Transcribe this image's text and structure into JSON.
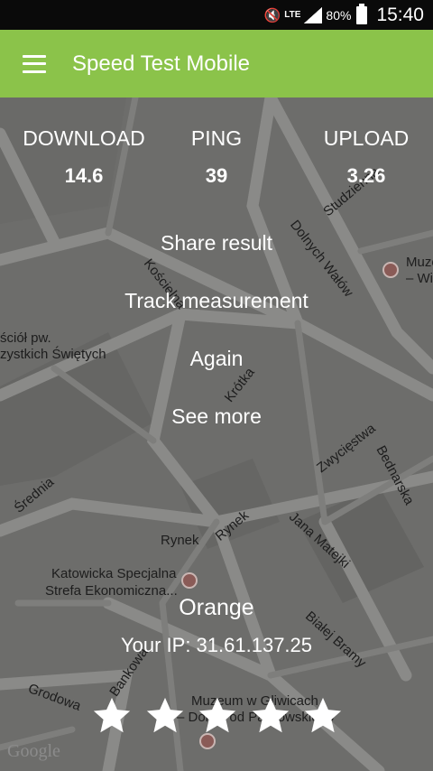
{
  "status_bar": {
    "time": "15:40",
    "battery": "80%",
    "network": "LTE"
  },
  "app_bar": {
    "title": "Speed Test Mobile"
  },
  "results": {
    "download": {
      "label": "DOWNLOAD",
      "value": "14.6"
    },
    "ping": {
      "label": "PING",
      "value": "39"
    },
    "upload": {
      "label": "UPLOAD",
      "value": "3.26"
    }
  },
  "actions": {
    "share": "Share result",
    "track": "Track measurement",
    "again": "Again",
    "see_more": "See more"
  },
  "connection": {
    "operator": "Orange",
    "ip": "Your IP: 31.61.137.25"
  },
  "rating": {
    "stars": 5
  },
  "map": {
    "labels": {
      "studzienna": "Studzienna",
      "dolnych_walow": "Dolnych Wałów",
      "koscielna": "Kościelna",
      "krotka": "Krótka",
      "kosciol_1": "ściół pw.",
      "kosciol_2": "zystkich Świętych",
      "muzeum_top_1": "Muze",
      "muzeum_top_2": "– Wi",
      "zwyciestwa": "Zwycięstwa",
      "bednarska": "Bednarska",
      "srednia": "Średnia",
      "rynek_1": "Rynek",
      "rynek_2": "Rynek",
      "jana_matejki": "Jana Matejki",
      "katowicka_1": "Katowicka Specjalna",
      "katowicka_2": "Strefa Ekonomiczna...",
      "bialej_bramy": "Białej Bramy",
      "bankowa": "Bankowa",
      "grodowa": "Grodowa",
      "muzeum_bottom_1": "Muzeum w Gliwicach",
      "muzeum_bottom_2": "– Dom Pod Pawlowskiego"
    },
    "attribution": "Google"
  }
}
